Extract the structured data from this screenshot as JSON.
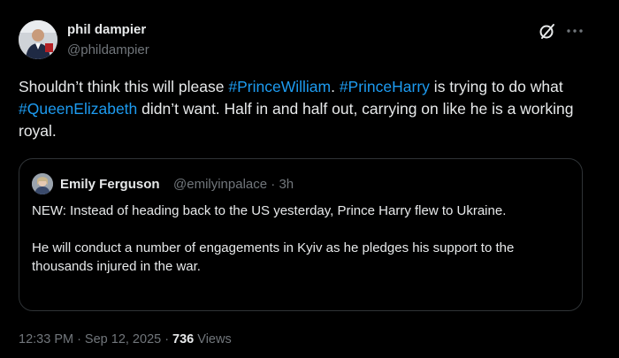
{
  "author": {
    "name": "phil dampier",
    "handle": "@phildampier"
  },
  "tweet": {
    "segments": [
      {
        "text": "Shouldn’t think this will please ",
        "tag": false
      },
      {
        "text": "#PrinceWilliam",
        "tag": true
      },
      {
        "text": ". ",
        "tag": false
      },
      {
        "text": "#PrinceHarry",
        "tag": true
      },
      {
        "text": " is trying to do what ",
        "tag": false
      },
      {
        "text": "#QueenElizabeth",
        "tag": true
      },
      {
        "text": " didn’t want. Half in and half out, carrying on like he is a working royal.",
        "tag": false
      }
    ]
  },
  "quote": {
    "name": "Emily Ferguson",
    "handle": "@emilyinpalace",
    "dot": "·",
    "time": "3h",
    "paragraph1": "NEW: Instead of heading back to the US yesterday, Prince Harry flew to Ukraine.",
    "paragraph2": "He will conduct a number of engagements in Kyiv as he pledges his support to the thousands injured in the war."
  },
  "footer": {
    "time": "12:33 PM",
    "dot": "·",
    "date": "Sep 12, 2025",
    "views_count": "736",
    "views_label": "Views"
  },
  "icons": {
    "grok": "grok-icon",
    "more": "more-icon"
  },
  "colors": {
    "background": "#000000",
    "text": "#e7e9ea",
    "muted": "#71767b",
    "link": "#1d9bf0",
    "border": "#2f3336"
  }
}
